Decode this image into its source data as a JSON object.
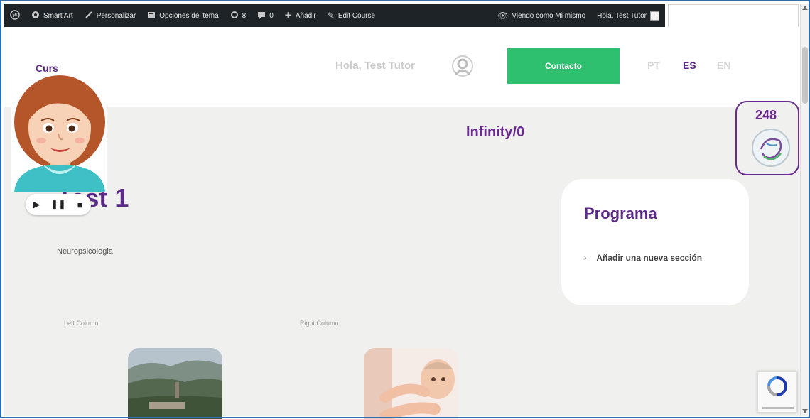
{
  "admin_bar": {
    "items": [
      {
        "icon": "wordpress-icon",
        "label": ""
      },
      {
        "icon": "dashboard-icon",
        "label": "Smart Art"
      },
      {
        "icon": "brush-icon",
        "label": "Personalizar"
      },
      {
        "icon": "theme-options-icon",
        "label": "Opciones del tema"
      },
      {
        "icon": "updates-icon",
        "label": "8"
      },
      {
        "icon": "comment-icon",
        "label": "0"
      },
      {
        "icon": "plus-icon",
        "label": "Añadir"
      },
      {
        "icon": "pencil-icon",
        "label": "Edit Course"
      }
    ],
    "view_as": "Viendo como Mi mismo",
    "greeting": "Hola, Test Tutor"
  },
  "header": {
    "logo_text": "Curs",
    "greeting": "Hola, Test Tutor",
    "contact_label": "Contacto",
    "languages": [
      "PT",
      "ES",
      "EN"
    ],
    "active_language": "ES"
  },
  "main": {
    "infinity_label": "Infinity/0",
    "counter": "248",
    "title": "Test 1",
    "subject": "Neuropsicologia",
    "program": {
      "title": "Programa",
      "items": [
        "Añadir una nueva sección"
      ]
    },
    "left_column_label": "Left Column",
    "right_column_label": "Right Column"
  },
  "player": {
    "play": "▶",
    "pause": "❚❚",
    "stop": "■"
  },
  "colors": {
    "brand_purple": "#5b2a86",
    "contact_green": "#2ec06f",
    "admin_bar": "#1d2327",
    "main_bg": "#f0f0ee"
  }
}
